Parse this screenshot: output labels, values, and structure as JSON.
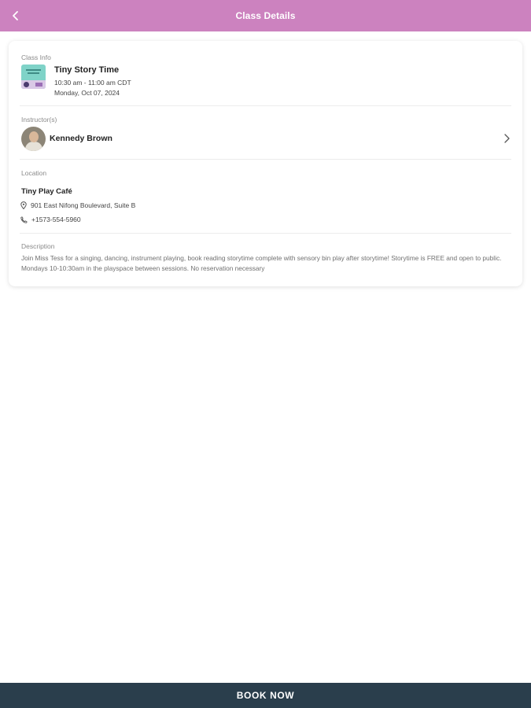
{
  "header": {
    "title": "Class Details",
    "background": "#cc82bf"
  },
  "class_info": {
    "label": "Class Info",
    "title": "Tiny Story Time",
    "time": "10:30 am - 11:00 am CDT",
    "date": "Monday, Oct 07, 2024"
  },
  "instructors": {
    "label": "Instructor(s)",
    "name": "Kennedy Brown"
  },
  "location": {
    "label": "Location",
    "name": "Tiny Play Café",
    "address": "901 East Nifong Boulevard, Suite B",
    "phone": "+1573-554-5960"
  },
  "description": {
    "label": "Description",
    "text": "Join Miss Tess for a singing, dancing, instrument playing, book reading storytime complete with sensory bin play after storytime!  Storytime is FREE and open to public.  Mondays 10-10:30am in the playspace between sessions.  No reservation necessary"
  },
  "footer": {
    "book_label": "BOOK NOW",
    "background": "#2a3e4c"
  },
  "icons": {
    "back": "chevron-left-icon",
    "instructor_arrow": "chevron-right-icon",
    "address": "map-pin-icon",
    "phone": "phone-icon"
  }
}
